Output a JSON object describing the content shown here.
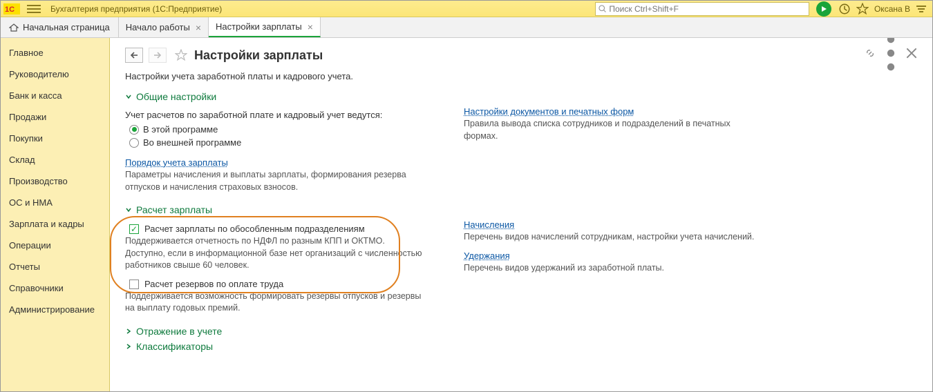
{
  "titlebar": {
    "app_title": "Бухгалтерия предприятия  (1С:Предприятие)",
    "search_placeholder": "Поиск Ctrl+Shift+F",
    "user_name": "Оксана В"
  },
  "tabs": {
    "home": "Начальная страница",
    "items": [
      {
        "label": "Начало работы",
        "active": false
      },
      {
        "label": "Настройки зарплаты",
        "active": true
      }
    ]
  },
  "sidebar": {
    "items": [
      "Главное",
      "Руководителю",
      "Банк и касса",
      "Продажи",
      "Покупки",
      "Склад",
      "Производство",
      "ОС и НМА",
      "Зарплата и кадры",
      "Операции",
      "Отчеты",
      "Справочники",
      "Администрирование"
    ]
  },
  "page": {
    "title": "Настройки зарплаты",
    "subtitle": "Настройки учета заработной платы и кадрового учета."
  },
  "sections": {
    "general": {
      "title": "Общие настройки",
      "lead": "Учет расчетов по заработной плате и кадровый учет ведутся:",
      "radio_this": "В этой программе",
      "radio_ext": "Во внешней программе",
      "order_link": "Порядок учета зарплаты",
      "order_desc": "Параметры начисления и выплаты зарплаты, формирования резерва отпусков и начисления страховых взносов.",
      "docs_link": "Настройки документов и печатных форм",
      "docs_desc": "Правила вывода списка сотрудников и подразделений в печатных формах."
    },
    "calc": {
      "title": "Расчет зарплаты",
      "chk_separate": "Расчет зарплаты по обособленным подразделениям",
      "chk_separate_desc": "Поддерживается отчетность по НДФЛ по разным КПП и ОКТМО. Доступно, если в информационной базе нет организаций с численностью работников свыше 60 человек.",
      "chk_reserve": "Расчет резервов по оплате труда",
      "chk_reserve_desc": "Поддерживается возможность формировать резервы отпусков и резервы на выплату годовых премий.",
      "accruals_link": "Начисления",
      "accruals_desc": "Перечень видов начислений сотрудникам, настройки учета начислений.",
      "deductions_link": "Удержания",
      "deductions_desc": "Перечень видов удержаний из заработной платы."
    },
    "reflection": {
      "title": "Отражение в учете"
    },
    "classifiers": {
      "title": "Классификаторы"
    }
  }
}
